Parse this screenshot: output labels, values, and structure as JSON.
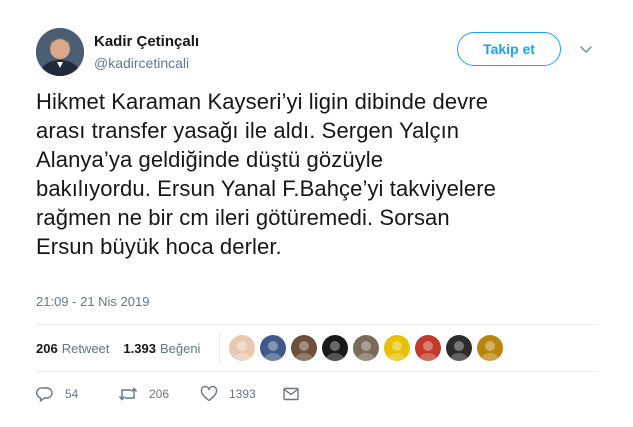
{
  "author": {
    "name": "Kadir Çetinçalı",
    "handle": "@kadircetincali"
  },
  "follow_label": "Takip et",
  "tweet_lines": [
    "Hikmet Karaman Kayseri’yi ligin dibinde devre",
    "arası transfer yasağı ile aldı. Sergen Yalçın",
    "Alanya’ya geldiğinde düştü gözüyle",
    "bakılıyordu. Ersun Yanal F.Bahçe’yi takviyelere",
    "rağmen ne bir cm ileri götüremedi. Sorsan",
    "Ersun büyük hoca derler."
  ],
  "timestamp": "21:09 - 21 Nis 2019",
  "stats": {
    "retweets_count": "206",
    "retweets_label": "Retweet",
    "likes_count": "1.393",
    "likes_label": "Beğeni"
  },
  "liker_avatars": [
    {
      "icon": "liker-avatar-1",
      "color": "#e8c9b0"
    },
    {
      "icon": "liker-avatar-2",
      "color": "#3d5a8a"
    },
    {
      "icon": "liker-avatar-3",
      "color": "#6b4f3a"
    },
    {
      "icon": "liker-avatar-4",
      "color": "#1a1a1a"
    },
    {
      "icon": "liker-avatar-5",
      "color": "#7a6a5a"
    },
    {
      "icon": "liker-avatar-6",
      "color": "#e6c200"
    },
    {
      "icon": "liker-avatar-7",
      "color": "#c0392b"
    },
    {
      "icon": "liker-avatar-8",
      "color": "#2b2b2b"
    },
    {
      "icon": "liker-avatar-9",
      "color": "#b8860b"
    }
  ],
  "actions": {
    "reply_count": "54",
    "retweet_count": "206",
    "like_count": "1393"
  },
  "colors": {
    "accent": "#1da1f2",
    "secondary_text": "#657786",
    "primary_text": "#14171a",
    "divider": "#e6ecf0"
  }
}
